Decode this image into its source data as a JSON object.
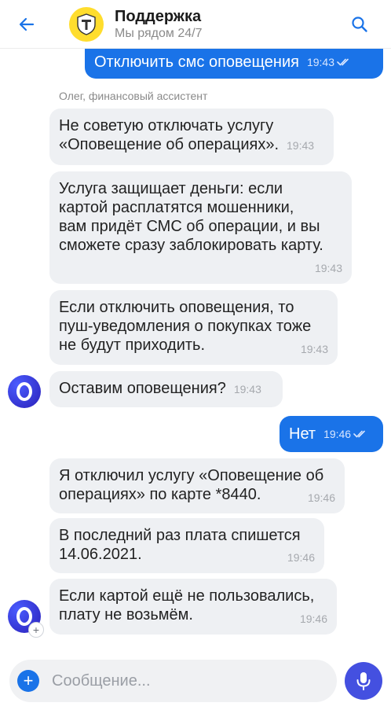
{
  "header": {
    "title": "Поддержка",
    "subtitle": "Мы рядом 24/7"
  },
  "messages": {
    "m0": {
      "text": "Отключить смс оповещения",
      "time": "19:43",
      "status": "read"
    },
    "sender_name": "Олег, финансовый ассистент",
    "m1": {
      "line1": "Не советую отключать услугу",
      "line2": "«Оповещение об операциях».",
      "time": "19:43"
    },
    "m2": {
      "line1": "Услуга защищает деньги: если",
      "line2": "картой расплатятся мошенники,",
      "line3": "вам придёт СМС об операции, и вы",
      "line4": "сможете сразу заблокировать карту.",
      "time": "19:43"
    },
    "m3": {
      "line1": "Если отключить оповещения, то",
      "line2": "пуш-уведомления о покупках тоже",
      "line3": "не будут приходить.",
      "time": "19:43"
    },
    "m4": {
      "text": "Оставим оповещения?",
      "time": "19:43"
    },
    "m5": {
      "text": "Нет",
      "time": "19:46",
      "status": "read"
    },
    "m6": {
      "line1": "Я отключил услугу «Оповещение об",
      "line2": "операциях» по карте *8440.",
      "time": "19:46"
    },
    "m7": {
      "line1": "В последний раз плата спишется",
      "line2": "14.06.2021.",
      "time": "19:46"
    },
    "m8": {
      "line1": "Если картой ещё не пользовались,",
      "line2": "плату не возьмём.",
      "time": "19:46"
    }
  },
  "composer": {
    "placeholder": "Сообщение..."
  },
  "colors": {
    "accent": "#1a73e8",
    "incoming_bubble": "#eef0f3",
    "brand_yellow": "#ffdd2d",
    "assistant_avatar": "#3b3fe0"
  },
  "icons": {
    "back": "arrow-left-icon",
    "logo": "bank-shield-logo",
    "search": "search-icon",
    "read": "double-check-icon",
    "attach": "plus-icon",
    "mic": "microphone-icon"
  }
}
